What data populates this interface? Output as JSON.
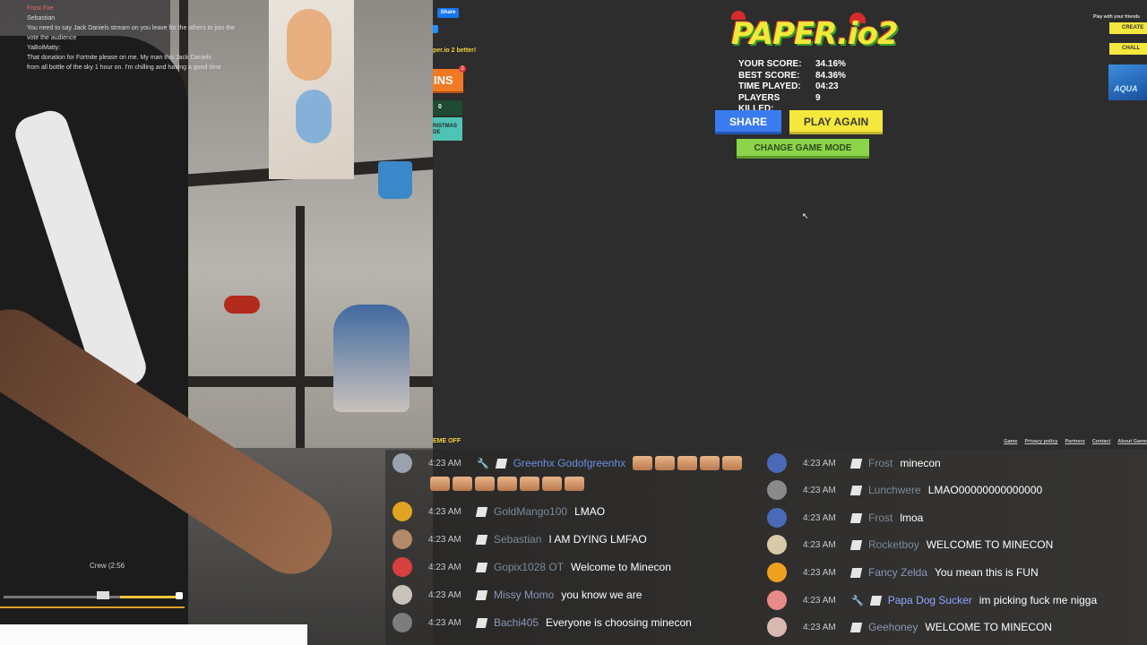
{
  "webcam": {
    "chat_lines": [
      "Frost Fire",
      "Sebastian",
      "You need to say Jack Daniels stream on you leave for the others to join the",
      "vote the audience",
      "YaBoiMatty:",
      "That donation for Fortnite please on me. My man this Jack Daniels",
      "from all bottle of the sky 1 hour on. I'm chilling and having a good time"
    ],
    "player_title": "Crew (2:56"
  },
  "game": {
    "share_small": "Share",
    "better_text": "per.io 2 better!",
    "skins_label": "INS",
    "skins_badge": "2",
    "coins": "0",
    "christmas_label_1": "RISTMAS",
    "christmas_label_2": "DE",
    "logo_text": "PAPER.io2",
    "stats": [
      {
        "label": "YOUR SCORE:",
        "value": "34.16%"
      },
      {
        "label": "BEST SCORE:",
        "value": "84.36%"
      },
      {
        "label": "TIME PLAYED:",
        "value": "04:23"
      },
      {
        "label": "PLAYERS KILLED:",
        "value": "9"
      }
    ],
    "share_button": "SHARE",
    "play_again_button": "PLAY AGAIN",
    "change_mode_button": "CHANGE GAME MODE",
    "friends_text": "Play with your friends",
    "create_button": "CREATE",
    "challenge_button": "CHALL",
    "aqua_label": "AQUA",
    "theme_toggle": "EME OFF",
    "footer_links": [
      "Game",
      "Privacy policy",
      "Partners",
      "Contact",
      "About Game"
    ]
  },
  "chat": {
    "left": [
      {
        "time": "4:23 AM",
        "name": "Greenhx Godofgreenhx",
        "name_color": "#6a8fe0",
        "text": "",
        "emotes": 6,
        "mod": true
      },
      {
        "time": "4:23 AM",
        "name": "GoldMango100",
        "name_color": "#7a8ea3",
        "text": "LMAO"
      },
      {
        "time": "4:23 AM",
        "name": "Sebastian",
        "name_color": "#7a8ea3",
        "text": "I AM DYING LMFAO"
      },
      {
        "time": "4:23 AM",
        "name": "Gopix1028 OT",
        "name_color": "#7a8ea3",
        "text": "Welcome to Minecon"
      },
      {
        "time": "4:23 AM",
        "name": "Missy Momo",
        "name_color": "#8a96b8",
        "text": "you know we are"
      },
      {
        "time": "4:23 AM",
        "name": "Bachi405",
        "name_color": "#8a96b8",
        "text": "Everyone is choosing minecon"
      }
    ],
    "right": [
      {
        "time": "4:23 AM",
        "name": "Frost",
        "name_color": "#7a8ea3",
        "text": "minecon"
      },
      {
        "time": "4:23 AM",
        "name": "Lunchwere",
        "name_color": "#7a8ea3",
        "text": "LMAO00000000000000"
      },
      {
        "time": "4:23 AM",
        "name": "Frost",
        "name_color": "#7a8ea3",
        "text": "lmoa"
      },
      {
        "time": "4:23 AM",
        "name": "Rocketboy",
        "name_color": "#7a8ea3",
        "text": "WELCOME TO MINECON"
      },
      {
        "time": "4:23 AM",
        "name": "Fancy Zelda",
        "name_color": "#8a96b8",
        "text": "You mean this is FUN"
      },
      {
        "time": "4:23 AM",
        "name": "Papa Dog Sucker",
        "name_color": "#8ea6ff",
        "text": "im picking fuck me nigga",
        "mod": true
      },
      {
        "time": "4:23 AM",
        "name": "Geehoney",
        "name_color": "#8a96b8",
        "text": "WELCOME TO MINECON"
      }
    ]
  }
}
